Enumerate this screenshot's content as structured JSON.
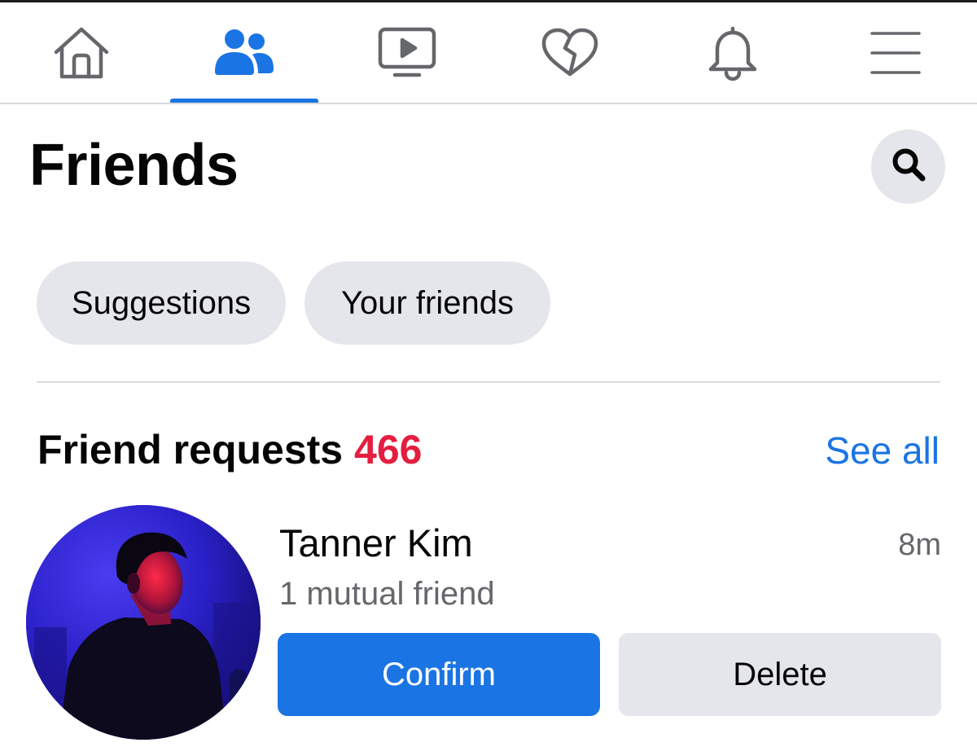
{
  "nav": {
    "tabs": [
      {
        "id": "home",
        "icon": "home-icon",
        "active": false
      },
      {
        "id": "friends",
        "icon": "friends-icon",
        "active": true
      },
      {
        "id": "watch",
        "icon": "video-icon",
        "active": false
      },
      {
        "id": "dating",
        "icon": "heart-icon",
        "active": false
      },
      {
        "id": "notifications",
        "icon": "bell-icon",
        "active": false
      },
      {
        "id": "menu",
        "icon": "hamburger-menu-icon",
        "active": false
      }
    ]
  },
  "header": {
    "title": "Friends",
    "search_icon": "search-icon"
  },
  "chips": {
    "suggestions": "Suggestions",
    "your_friends": "Your friends"
  },
  "requests": {
    "title": "Friend requests",
    "count": "466",
    "see_all": "See all",
    "items": [
      {
        "name": "Tanner Kim",
        "mutual": "1 mutual friend",
        "time": "8m",
        "confirm_label": "Confirm",
        "delete_label": "Delete"
      }
    ]
  },
  "colors": {
    "accent": "#1b74e4",
    "count": "#e41e3f",
    "chip_bg": "#e4e6eb",
    "secondary_text": "#65676b",
    "icon_gray": "#65676b"
  }
}
